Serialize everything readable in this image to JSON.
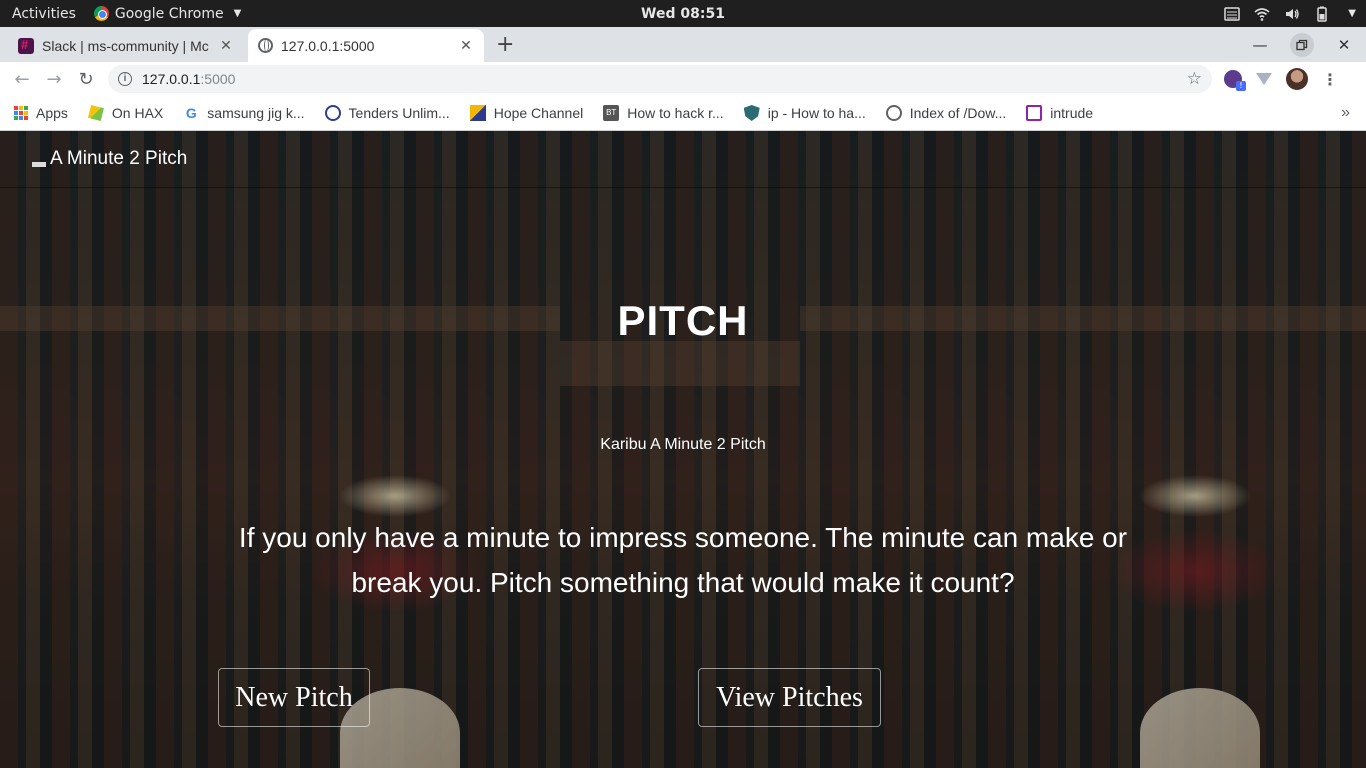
{
  "os_bar": {
    "activities": "Activities",
    "app_name": "Google Chrome",
    "clock": "Wed 08:51",
    "icons": [
      "menu-icon",
      "wifi-icon",
      "volume-icon",
      "battery-icon",
      "chevron-down-icon"
    ]
  },
  "tabs": [
    {
      "title": "Slack | ms-community | Mc",
      "favicon": "slack-icon",
      "active": false
    },
    {
      "title": "127.0.0.1:5000",
      "favicon": "globe-icon",
      "active": true
    }
  ],
  "address_bar": {
    "host": "127.0.0.1",
    "rest": ":5000"
  },
  "bookmarks": [
    {
      "label": "Apps",
      "icon": "apps-grid-icon"
    },
    {
      "label": "On HAX",
      "icon": "hax-icon"
    },
    {
      "label": "samsung jig k...",
      "icon": "google-icon"
    },
    {
      "label": "Tenders Unlim...",
      "icon": "tenders-icon"
    },
    {
      "label": "Hope Channel",
      "icon": "hope-channel-icon"
    },
    {
      "label": "How to hack r...",
      "icon": "bt-icon"
    },
    {
      "label": "ip - How to ha...",
      "icon": "shield-icon"
    },
    {
      "label": "Index of /Dow...",
      "icon": "globe-icon"
    },
    {
      "label": "intrude",
      "icon": "floppy-icon"
    }
  ],
  "site": {
    "brand": "A Minute 2 Pitch",
    "title": "PITCH",
    "subtitle": "Karibu A Minute 2 Pitch",
    "tagline": "If you only have a minute to impress someone. The minute can make or break you. Pitch something that would make it count?",
    "buttons": {
      "new_pitch": "New Pitch",
      "view_pitches": "View Pitches"
    }
  }
}
